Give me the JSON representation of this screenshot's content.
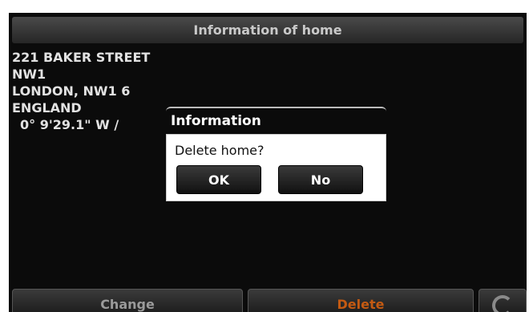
{
  "header": {
    "title": "Information of home"
  },
  "address": {
    "lines": [
      "221 BAKER STREET",
      "NW1",
      "LONDON, NW1 6",
      "ENGLAND"
    ],
    "coordinates": "0° 9'29.1\" W /"
  },
  "dialog": {
    "title": "Information",
    "message": "Delete home?",
    "ok_label": "OK",
    "no_label": "No"
  },
  "footer": {
    "change_label": "Change",
    "delete_label": "Delete"
  },
  "colors": {
    "screen_bg": "#0b0b0b",
    "delete_accent": "#c45a12"
  }
}
